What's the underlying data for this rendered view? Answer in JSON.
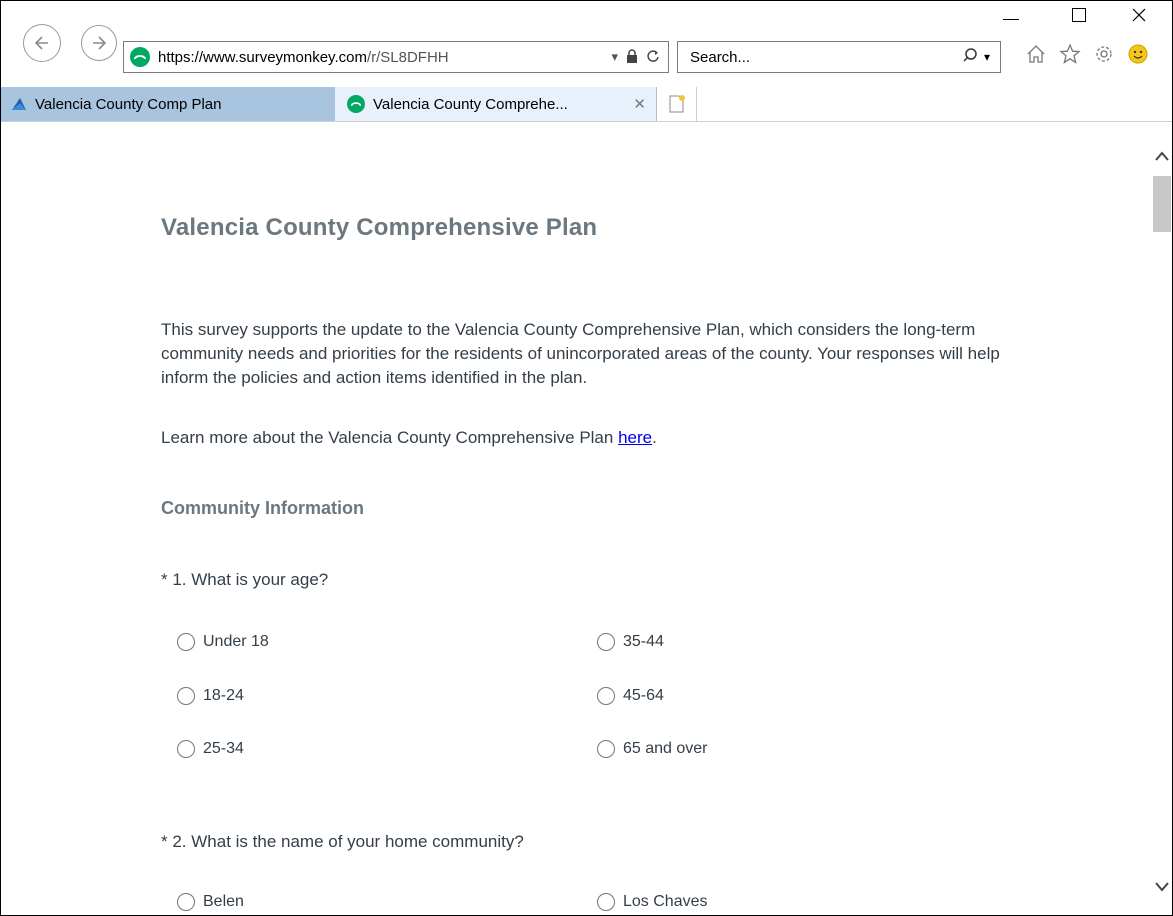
{
  "browser": {
    "url_host": "https://www.surveymonkey.com",
    "url_path": "/r/SL8DFHH",
    "search_placeholder": "Search...",
    "tabs": [
      {
        "label": "Valencia County Comp Plan"
      },
      {
        "label": "Valencia County Comprehe..."
      }
    ]
  },
  "survey": {
    "title": "Valencia County Comprehensive Plan",
    "intro": "This survey supports the update to the Valencia County Comprehensive Plan, which considers the long-term community needs and priorities for the residents of unincorporated areas of the county. Your responses will help inform the policies and action items identified in the plan.",
    "learn_text": "Learn more about the Valencia County Comprehensive Plan ",
    "learn_link": "here",
    "learn_end": ".",
    "section": "Community Information",
    "q1": {
      "text": "* 1. What is your age?",
      "options": [
        "Under 18",
        "18-24",
        "25-34",
        "35-44",
        "45-64",
        "65 and over"
      ]
    },
    "q2": {
      "text": "* 2. What is the name of your home community?",
      "options": [
        "Belen",
        "Los Chaves"
      ]
    }
  }
}
